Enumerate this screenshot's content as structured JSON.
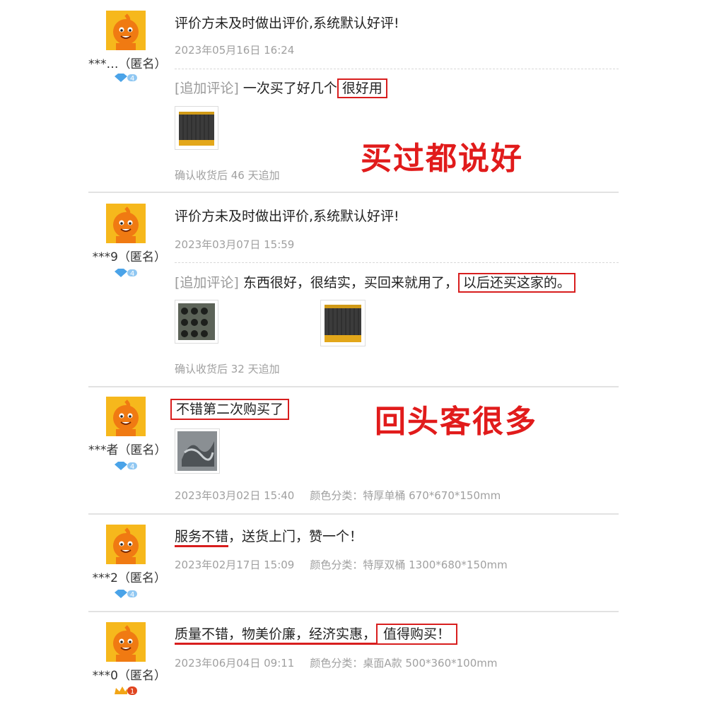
{
  "reviews": [
    {
      "username": "***…（匿名）",
      "text": "评价方未及时做出评价,系统默认好评!",
      "date": "2023年05月16日 16:24",
      "append_label": "[追加评论]",
      "append_text": "一次买了好几个",
      "append_highlight": "很好用",
      "append_note": "确认收货后 46 天追加",
      "level": "4"
    },
    {
      "username": "***9（匿名）",
      "text": "评价方未及时做出评价,系统默认好评!",
      "date": "2023年03月07日 15:59",
      "append_label": "[追加评论]",
      "append_text": "东西很好，很结实，买回来就用了，",
      "append_highlight": "以后还买这家的。",
      "append_note": "确认收货后 32 天追加",
      "level": "4"
    },
    {
      "username": "***者（匿名）",
      "text_highlight": "不错第二次购买了",
      "date": "2023年03月02日 15:40",
      "spec": "颜色分类：特厚单桶 670*670*150mm",
      "level": "4"
    },
    {
      "username": "***2（匿名）",
      "text_underline": "服务不错",
      "text_rest": "，送货上门，赞一个！",
      "date": "2023年02月17日 15:09",
      "spec": "颜色分类：特厚双桶 1300*680*150mm",
      "level": "4"
    },
    {
      "username": "***0（匿名）",
      "text_underline": "质量不错，物美价廉，经济实惠，",
      "text_highlight": "值得购买！",
      "date": "2023年06月04日 09:11",
      "spec": "颜色分类：桌面A款 500*360*100mm",
      "level": "1"
    }
  ],
  "slogans": {
    "first": "买过都说好",
    "second": "回头客很多"
  },
  "colors": {
    "accent_red": "#e11b1b",
    "avatar_orange": "#f6b81c",
    "badge_blue": "#4aa3e8"
  },
  "icons": [
    "avatar-icon",
    "diamond-level-icon",
    "crown-level-icon"
  ]
}
